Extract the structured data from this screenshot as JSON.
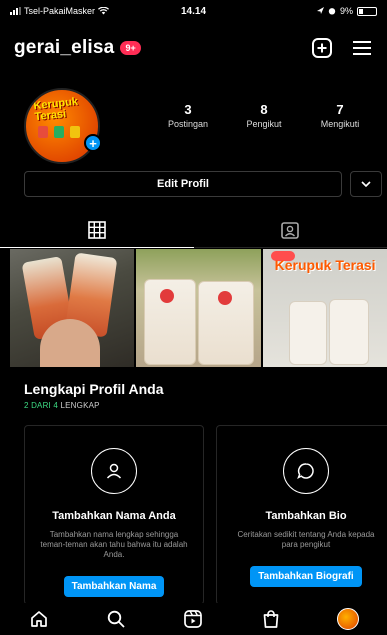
{
  "status_bar": {
    "carrier": "Tsel-PakaiMasker",
    "time": "14.14",
    "battery_text": "9%"
  },
  "header": {
    "username": "gerai_elisa",
    "notification_badge": "9+"
  },
  "profile": {
    "avatar_text": "Kerupuk Terasi",
    "stats": [
      {
        "value": "3",
        "label": "Postingan"
      },
      {
        "value": "8",
        "label": "Pengikut"
      },
      {
        "value": "7",
        "label": "Mengikuti"
      }
    ],
    "edit_button_label": "Edit Profil"
  },
  "grid": {
    "post3_text": "Kerupuk Terasi"
  },
  "complete_profile": {
    "title": "Lengkapi Profil Anda",
    "progress_done": "2 DARI 4",
    "progress_rest": "LENGKAP"
  },
  "cards": [
    {
      "icon": "person-icon",
      "title": "Tambahkan Nama Anda",
      "description": "Tambahkan nama lengkap sehingga teman-teman akan tahu bahwa itu adalah Anda.",
      "button": "Tambahkan Nama"
    },
    {
      "icon": "speech-bubble-icon",
      "title": "Tambahkan Bio",
      "description": "Ceritakan sedikit tentang Anda kepada para pengikut",
      "button": "Tambahkan Biografi"
    }
  ],
  "colors": {
    "accent_blue": "#0095f6",
    "badge_red": "#ff2d55",
    "progress_green": "#3ddc84"
  }
}
